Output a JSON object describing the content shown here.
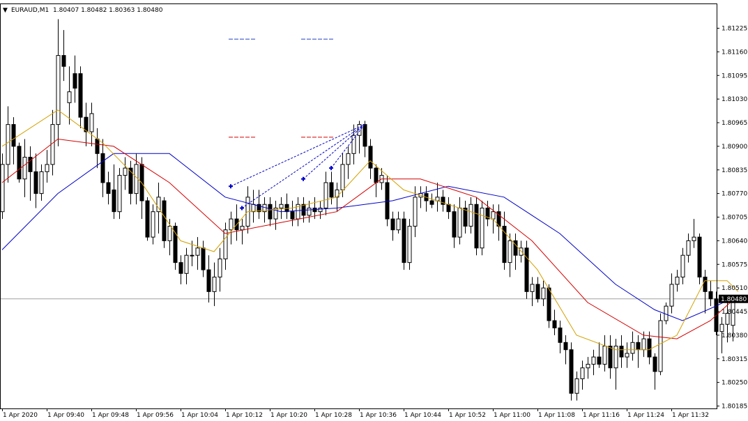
{
  "header": {
    "arrow": "▼",
    "symbol_timeframe": "EURAUD,M1",
    "ohlc": "1.80407 1.80482 1.80363 1.80480"
  },
  "price_axis": {
    "ticks": [
      "1.81225",
      "1.81160",
      "1.81095",
      "1.81030",
      "1.80965",
      "1.80900",
      "1.80835",
      "1.80770",
      "1.80705",
      "1.80640",
      "1.80575",
      "1.80510",
      "1.80445",
      "1.80380",
      "1.80315",
      "1.80250",
      "1.80185"
    ],
    "current_price": "1.80480"
  },
  "time_axis": {
    "ticks": [
      "1 Apr 2020",
      "1 Apr 09:40",
      "1 Apr 09:48",
      "1 Apr 09:56",
      "1 Apr 10:04",
      "1 Apr 10:12",
      "1 Apr 10:20",
      "1 Apr 10:28",
      "1 Apr 10:36",
      "1 Apr 10:44",
      "1 Apr 10:52",
      "1 Apr 11:00",
      "1 Apr 11:08",
      "1 Apr 11:16",
      "1 Apr 11:24",
      "1 Apr 11:32"
    ]
  },
  "colors": {
    "background": "#ffffff",
    "bull_body": "#ffffff",
    "bear_body": "#000000",
    "ma_slow": "#0000c8",
    "ma_mid": "#d40000",
    "ma_fast": "#d4a000",
    "fractal_marks": "#0000c8",
    "level_blue": "#2040c0",
    "level_red": "#d40000",
    "price_line": "#a0a0a0",
    "price_label_bg": "#000000",
    "price_label_text": "#ffffff"
  },
  "chart_data": {
    "type": "candlestick",
    "title": "EURAUD,M1",
    "ylim": [
      1.8017,
      1.813
    ],
    "candles": [
      [
        1.8072,
        1.8088,
        1.807,
        1.8085
      ],
      [
        1.8085,
        1.8101,
        1.808,
        1.8096
      ],
      [
        1.8096,
        1.8098,
        1.8085,
        1.809
      ],
      [
        1.809,
        1.8091,
        1.808,
        1.8081
      ],
      [
        1.8081,
        1.8092,
        1.8076,
        1.8087
      ],
      [
        1.8087,
        1.809,
        1.8075,
        1.8083
      ],
      [
        1.8083,
        1.8088,
        1.8073,
        1.8077
      ],
      [
        1.8077,
        1.8085,
        1.8075,
        1.8083
      ],
      [
        1.8083,
        1.8089,
        1.808,
        1.8085
      ],
      [
        1.8085,
        1.81,
        1.8082,
        1.8096
      ],
      [
        1.8096,
        1.8125,
        1.809,
        1.8115
      ],
      [
        1.8115,
        1.8122,
        1.8108,
        1.8112
      ],
      [
        1.8102,
        1.8112,
        1.8096,
        1.8105
      ],
      [
        1.811,
        1.8115,
        1.8102,
        1.8106
      ],
      [
        1.811,
        1.8112,
        1.8095,
        1.8098
      ],
      [
        1.8098,
        1.8102,
        1.809,
        1.8094
      ],
      [
        1.8094,
        1.8102,
        1.809,
        1.8099
      ],
      [
        1.8092,
        1.8095,
        1.8084,
        1.8088
      ],
      [
        1.8088,
        1.8092,
        1.8076,
        1.808
      ],
      [
        1.808,
        1.8083,
        1.8074,
        1.8077
      ],
      [
        1.8078,
        1.8085,
        1.807,
        1.8072
      ],
      [
        1.8072,
        1.8084,
        1.807,
        1.8082
      ],
      [
        1.8082,
        1.8087,
        1.8078,
        1.8084
      ],
      [
        1.8084,
        1.8086,
        1.8074,
        1.8077
      ],
      [
        1.8077,
        1.8088,
        1.8074,
        1.8085
      ],
      [
        1.8085,
        1.8087,
        1.807,
        1.8075
      ],
      [
        1.8075,
        1.8076,
        1.8064,
        1.8065
      ],
      [
        1.8065,
        1.8074,
        1.8063,
        1.8072
      ],
      [
        1.8072,
        1.808,
        1.8066,
        1.8076
      ],
      [
        1.8075,
        1.8076,
        1.8062,
        1.8064
      ],
      [
        1.8064,
        1.807,
        1.806,
        1.8068
      ],
      [
        1.8068,
        1.8069,
        1.8056,
        1.8058
      ],
      [
        1.8058,
        1.806,
        1.8052,
        1.8055
      ],
      [
        1.8055,
        1.8062,
        1.8052,
        1.806
      ],
      [
        1.806,
        1.8064,
        1.8057,
        1.806
      ],
      [
        1.806,
        1.8065,
        1.8056,
        1.8062
      ],
      [
        1.8062,
        1.8064,
        1.8054,
        1.8056
      ],
      [
        1.8056,
        1.806,
        1.8047,
        1.805
      ],
      [
        1.805,
        1.8058,
        1.8046,
        1.8054
      ],
      [
        1.8054,
        1.8062,
        1.805,
        1.8059
      ],
      [
        1.8059,
        1.8069,
        1.8056,
        1.8067
      ],
      [
        1.8067,
        1.8072,
        1.8063,
        1.807
      ],
      [
        1.807,
        1.8074,
        1.8064,
        1.8067
      ],
      [
        1.8067,
        1.807,
        1.8063,
        1.8068
      ],
      [
        1.8068,
        1.8079,
        1.8066,
        1.8076
      ],
      [
        1.8072,
        1.8078,
        1.8069,
        1.8074
      ],
      [
        1.8074,
        1.8078,
        1.807,
        1.8072
      ],
      [
        1.8072,
        1.8076,
        1.8069,
        1.8074
      ],
      [
        1.8074,
        1.8076,
        1.8068,
        1.807
      ],
      [
        1.807,
        1.8075,
        1.8067,
        1.8073
      ],
      [
        1.8073,
        1.8076,
        1.807,
        1.8074
      ],
      [
        1.8074,
        1.8077,
        1.807,
        1.8072
      ],
      [
        1.8072,
        1.8075,
        1.8068,
        1.807
      ],
      [
        1.807,
        1.8076,
        1.8068,
        1.8074
      ],
      [
        1.8074,
        1.8076,
        1.8069,
        1.8071
      ],
      [
        1.8071,
        1.8075,
        1.8069,
        1.8073
      ],
      [
        1.8073,
        1.8076,
        1.807,
        1.8072
      ],
      [
        1.8072,
        1.8075,
        1.807,
        1.8073
      ],
      [
        1.8073,
        1.8083,
        1.8071,
        1.808
      ],
      [
        1.808,
        1.8083,
        1.8074,
        1.8076
      ],
      [
        1.8076,
        1.808,
        1.8072,
        1.8078
      ],
      [
        1.8078,
        1.8088,
        1.8076,
        1.8085
      ],
      [
        1.8085,
        1.809,
        1.8081,
        1.8088
      ],
      [
        1.8088,
        1.8096,
        1.8085,
        1.8093
      ],
      [
        1.8093,
        1.8097,
        1.8088,
        1.8096
      ],
      [
        1.8096,
        1.8097,
        1.8087,
        1.809
      ],
      [
        1.809,
        1.8092,
        1.8081,
        1.8084
      ],
      [
        1.8084,
        1.8085,
        1.8076,
        1.808
      ],
      [
        1.808,
        1.8084,
        1.8078,
        1.8082
      ],
      [
        1.808,
        1.8082,
        1.8068,
        1.807
      ],
      [
        1.807,
        1.8072,
        1.8064,
        1.8067
      ],
      [
        1.8067,
        1.8072,
        1.8066,
        1.807
      ],
      [
        1.807,
        1.8072,
        1.8056,
        1.8058
      ],
      [
        1.8058,
        1.807,
        1.8056,
        1.8068
      ],
      [
        1.8068,
        1.8079,
        1.8065,
        1.8076
      ],
      [
        1.8076,
        1.8079,
        1.8073,
        1.8077
      ],
      [
        1.8077,
        1.8079,
        1.8072,
        1.8075
      ],
      [
        1.8075,
        1.8077,
        1.8073,
        1.8074
      ],
      [
        1.8075,
        1.808,
        1.8072,
        1.8076
      ],
      [
        1.8076,
        1.8078,
        1.8072,
        1.8074
      ],
      [
        1.8074,
        1.8076,
        1.807,
        1.8072
      ],
      [
        1.8072,
        1.8074,
        1.8062,
        1.8065
      ],
      [
        1.8065,
        1.8076,
        1.8063,
        1.8073
      ],
      [
        1.8073,
        1.8075,
        1.8066,
        1.8068
      ],
      [
        1.8068,
        1.8076,
        1.8066,
        1.8074
      ],
      [
        1.8074,
        1.8076,
        1.806,
        1.8062
      ],
      [
        1.8062,
        1.8075,
        1.806,
        1.8073
      ],
      [
        1.8073,
        1.8075,
        1.8068,
        1.807
      ],
      [
        1.807,
        1.8074,
        1.8066,
        1.8072
      ],
      [
        1.8072,
        1.8074,
        1.8064,
        1.8068
      ],
      [
        1.8068,
        1.8072,
        1.8056,
        1.8058
      ],
      [
        1.8058,
        1.8066,
        1.8054,
        1.8064
      ],
      [
        1.8064,
        1.8066,
        1.8056,
        1.806
      ],
      [
        1.806,
        1.8064,
        1.8058,
        1.8062
      ],
      [
        1.8062,
        1.8064,
        1.8048,
        1.805
      ],
      [
        1.805,
        1.8054,
        1.8046,
        1.8052
      ],
      [
        1.8052,
        1.8054,
        1.8047,
        1.8048
      ],
      [
        1.8048,
        1.8053,
        1.8046,
        1.8051
      ],
      [
        1.8051,
        1.8052,
        1.804,
        1.8042
      ],
      [
        1.8042,
        1.8045,
        1.8038,
        1.804
      ],
      [
        1.804,
        1.8042,
        1.8033,
        1.8036
      ],
      [
        1.8036,
        1.8038,
        1.803,
        1.8034
      ],
      [
        1.8034,
        1.8036,
        1.802,
        1.8022
      ],
      [
        1.8022,
        1.8028,
        1.802,
        1.8026
      ],
      [
        1.8026,
        1.8031,
        1.8023,
        1.8029
      ],
      [
        1.8029,
        1.8032,
        1.8026,
        1.803
      ],
      [
        1.803,
        1.8034,
        1.8027,
        1.8032
      ],
      [
        1.8032,
        1.8036,
        1.8029,
        1.803
      ],
      [
        1.803,
        1.8038,
        1.8028,
        1.8035
      ],
      [
        1.8035,
        1.8038,
        1.8026,
        1.8029
      ],
      [
        1.8029,
        1.8037,
        1.8023,
        1.8035
      ],
      [
        1.8035,
        1.8038,
        1.8029,
        1.8032
      ],
      [
        1.8032,
        1.8036,
        1.8029,
        1.8033
      ],
      [
        1.8033,
        1.8039,
        1.8031,
        1.8036
      ],
      [
        1.8036,
        1.8038,
        1.8029,
        1.8034
      ],
      [
        1.8034,
        1.8039,
        1.8032,
        1.8037
      ],
      [
        1.8037,
        1.8039,
        1.803,
        1.8032
      ],
      [
        1.8032,
        1.8033,
        1.8023,
        1.8028
      ],
      [
        1.8028,
        1.8044,
        1.8027,
        1.8042
      ],
      [
        1.8042,
        1.8047,
        1.8041,
        1.8046
      ],
      [
        1.8046,
        1.8055,
        1.8044,
        1.8052
      ],
      [
        1.8052,
        1.8056,
        1.805,
        1.8054
      ],
      [
        1.8054,
        1.8062,
        1.8052,
        1.806
      ],
      [
        1.806,
        1.8066,
        1.8058,
        1.8064
      ],
      [
        1.8064,
        1.807,
        1.8062,
        1.8065
      ],
      [
        1.8065,
        1.8066,
        1.8052,
        1.8054
      ],
      [
        1.8054,
        1.8056,
        1.8044,
        1.805
      ],
      [
        1.805,
        1.8053,
        1.8046,
        1.8048
      ],
      [
        1.8048,
        1.805,
        1.8038,
        1.8039
      ],
      [
        1.8039,
        1.8043,
        1.8033,
        1.8041
      ],
      [
        1.8041,
        1.8048,
        1.8036,
        1.8044
      ],
      [
        1.80407,
        1.80482,
        1.80363,
        1.8048
      ]
    ],
    "ma_slow": [
      [
        0,
        1.80615
      ],
      [
        10,
        1.8077
      ],
      [
        20,
        1.8088
      ],
      [
        30,
        1.8088
      ],
      [
        40,
        1.8076
      ],
      [
        50,
        1.8072
      ],
      [
        60,
        1.8073
      ],
      [
        70,
        1.8075
      ],
      [
        80,
        1.8079
      ],
      [
        90,
        1.8076
      ],
      [
        100,
        1.8066
      ],
      [
        110,
        1.8052
      ],
      [
        117,
        1.8045
      ],
      [
        122,
        1.8042
      ],
      [
        128,
        1.8046
      ],
      [
        132,
        1.8049
      ]
    ],
    "ma_mid": [
      [
        0,
        1.808
      ],
      [
        10,
        1.8092
      ],
      [
        20,
        1.809
      ],
      [
        30,
        1.808
      ],
      [
        40,
        1.8066
      ],
      [
        50,
        1.8069
      ],
      [
        60,
        1.8072
      ],
      [
        68,
        1.8081
      ],
      [
        75,
        1.8081
      ],
      [
        85,
        1.8076
      ],
      [
        95,
        1.8064
      ],
      [
        105,
        1.8047
      ],
      [
        115,
        1.8038
      ],
      [
        121,
        1.8037
      ],
      [
        127,
        1.8042
      ],
      [
        132,
        1.8049
      ]
    ],
    "ma_fast": [
      [
        0,
        1.809
      ],
      [
        10,
        1.81
      ],
      [
        18,
        1.8091
      ],
      [
        25,
        1.808
      ],
      [
        32,
        1.8064
      ],
      [
        38,
        1.8061
      ],
      [
        44,
        1.8072
      ],
      [
        52,
        1.8073
      ],
      [
        60,
        1.8076
      ],
      [
        66,
        1.8086
      ],
      [
        72,
        1.8078
      ],
      [
        80,
        1.8074
      ],
      [
        88,
        1.807
      ],
      [
        96,
        1.8056
      ],
      [
        103,
        1.8038
      ],
      [
        110,
        1.8034
      ],
      [
        116,
        1.8034
      ],
      [
        121,
        1.8038
      ],
      [
        126,
        1.8053
      ],
      [
        130,
        1.8053
      ],
      [
        132,
        1.805
      ]
    ],
    "fractals": [
      [
        41,
        1.8079
      ],
      [
        43,
        1.8073
      ],
      [
        54,
        1.8081
      ],
      [
        59,
        1.8084
      ]
    ],
    "fractal_apex": [
      65,
      1.8096
    ],
    "levels": {
      "blue": [
        [
          41,
          45,
          1.81195
        ],
        [
          54,
          59,
          1.81195
        ]
      ],
      "red": [
        [
          41,
          45,
          1.80925
        ],
        [
          54,
          59,
          1.80925
        ]
      ]
    }
  }
}
